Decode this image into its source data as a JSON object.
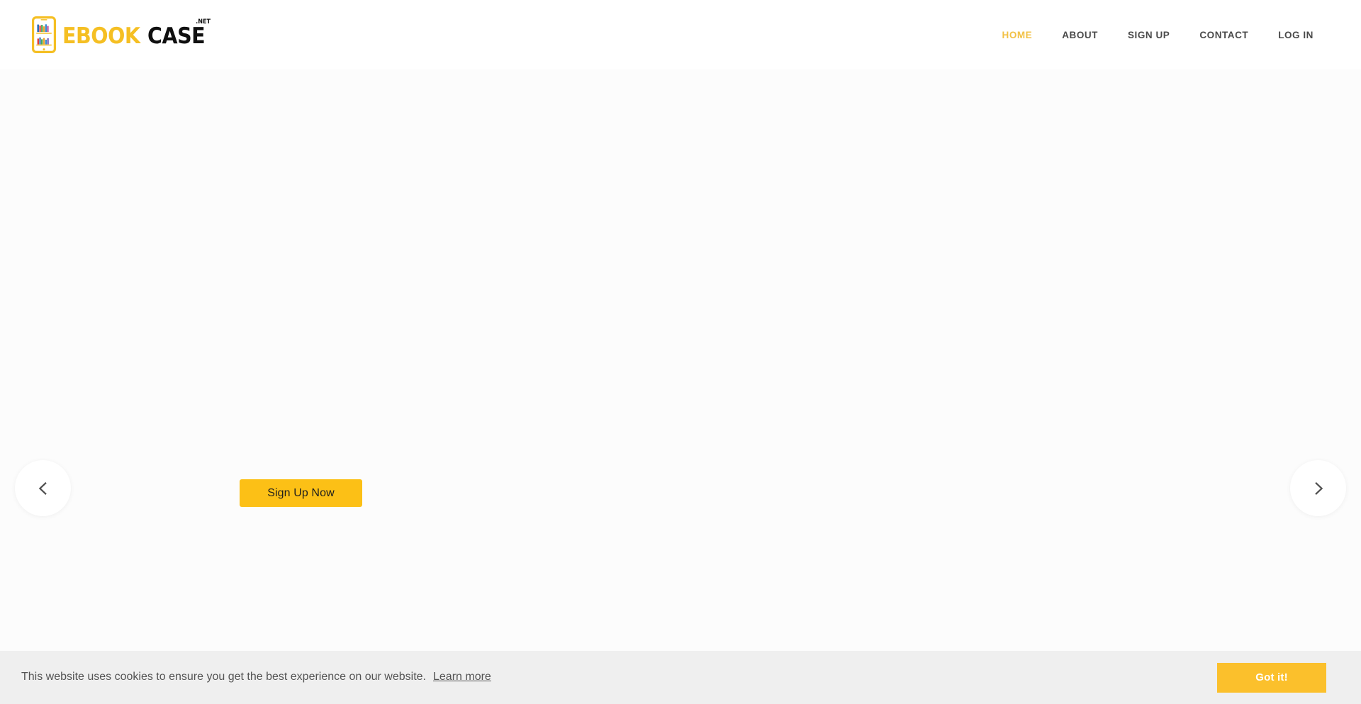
{
  "header": {
    "brand": {
      "name_part_one": "EBOOK",
      "name_part_two": "CASE",
      "tld": ".NET",
      "icon": "phone-bookshelf-icon"
    },
    "nav": [
      {
        "label": "HOME",
        "active": true,
        "name": "nav-link-home"
      },
      {
        "label": "ABOUT",
        "active": false,
        "name": "nav-link-about"
      },
      {
        "label": "SIGN UP",
        "active": false,
        "name": "nav-link-sign-up"
      },
      {
        "label": "CONTACT",
        "active": false,
        "name": "nav-link-contact"
      },
      {
        "label": "LOG IN",
        "active": false,
        "name": "nav-link-log-in"
      }
    ]
  },
  "hero": {
    "headline": "",
    "subline": "",
    "cta_label": "Sign Up Now",
    "prev_arrow_icon": "chevron-left-icon",
    "next_arrow_icon": "chevron-right-icon"
  },
  "cookie_banner": {
    "message": "This website uses cookies to ensure you get the best experience on our website.",
    "learn_more_label": "Learn more",
    "accept_label": "Got it!"
  },
  "colors": {
    "brand_yellow": "#f5bf23",
    "button_yellow": "#fcc016",
    "cookie_button_yellow": "#fbc02c",
    "nav_active": "#f2c145",
    "nav_text": "#4a4a4a",
    "cookie_bg": "#efefef",
    "hero_bg": "#fcfcfc"
  }
}
